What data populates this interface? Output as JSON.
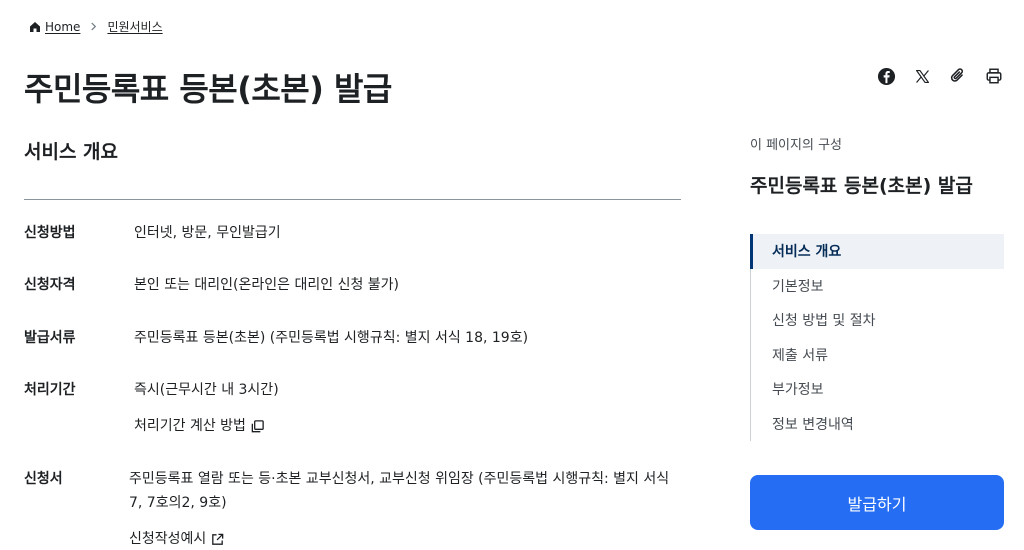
{
  "breadcrumb": {
    "home": "Home",
    "current": "민원서비스"
  },
  "page": {
    "title": "주민등록표 등본(초본) 발급"
  },
  "share": {
    "icons": [
      "facebook-icon",
      "x-icon",
      "link-icon",
      "print-icon"
    ]
  },
  "overview": {
    "title": "서비스 개요",
    "rows": [
      {
        "key": "신청방법",
        "value": "인터넷, 방문, 무인발급기"
      },
      {
        "key": "신청자격",
        "value": "본인 또는 대리인(온라인은 대리인 신청 불가)"
      },
      {
        "key": "발급서류",
        "value": "주민등록표 등본(초본) (주민등록법 시행규칙: 별지 서식 18, 19호)"
      },
      {
        "key": "처리기간",
        "value": "즉시(근무시간 내 3시간)",
        "link": "처리기간 계산 방법"
      },
      {
        "key": "신청서",
        "value": "주민등록표 열람 또는 등·초본 교부신청서, 교부신청 위임장 (주민등록법 시행규칙: 별지 서식 7, 7호의2, 9호)",
        "link": "신청작성예시"
      }
    ]
  },
  "toc": {
    "caption": "이 페이지의 구성",
    "title": "주민등록표 등본(초본) 발급",
    "items": [
      "서비스 개요",
      "기본정보",
      "신청 방법 및 절차",
      "제출 서류",
      "부가정보",
      "정보 변경내역"
    ],
    "active_index": 0
  },
  "action": {
    "issue_label": "발급하기"
  },
  "colors": {
    "primary": "#256ef4",
    "active_bar": "#003675",
    "active_bg": "#eef2f7",
    "text": "#1e2124"
  }
}
